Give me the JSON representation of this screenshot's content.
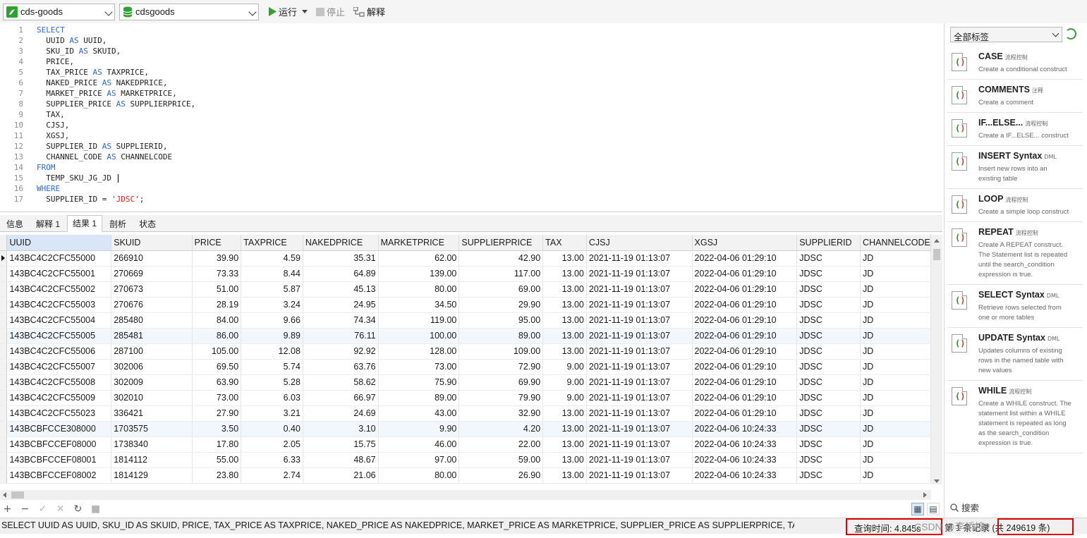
{
  "toolbar": {
    "connection": "cds-goods",
    "database": "cdsgoods",
    "run_label": "运行",
    "stop_label": "停止",
    "explain_label": "解释"
  },
  "editor": {
    "lines": [
      [
        {
          "t": "SELECT",
          "c": "kw"
        }
      ],
      [
        {
          "t": "  UUID "
        },
        {
          "t": "AS",
          "c": "kw"
        },
        {
          "t": " UUID,"
        }
      ],
      [
        {
          "t": "  SKU_ID "
        },
        {
          "t": "AS",
          "c": "kw"
        },
        {
          "t": " SKUID,"
        }
      ],
      [
        {
          "t": "  PRICE,"
        }
      ],
      [
        {
          "t": "  TAX_PRICE "
        },
        {
          "t": "AS",
          "c": "kw"
        },
        {
          "t": " TAXPRICE,"
        }
      ],
      [
        {
          "t": "  NAKED_PRICE "
        },
        {
          "t": "AS",
          "c": "kw"
        },
        {
          "t": " NAKEDPRICE,"
        }
      ],
      [
        {
          "t": "  MARKET_PRICE "
        },
        {
          "t": "AS",
          "c": "kw"
        },
        {
          "t": " MARKETPRICE,"
        }
      ],
      [
        {
          "t": "  SUPPLIER_PRICE "
        },
        {
          "t": "AS",
          "c": "kw"
        },
        {
          "t": " SUPPLIERPRICE,"
        }
      ],
      [
        {
          "t": "  TAX,"
        }
      ],
      [
        {
          "t": "  CJSJ,"
        }
      ],
      [
        {
          "t": "  XGSJ,"
        }
      ],
      [
        {
          "t": "  SUPPLIER_ID "
        },
        {
          "t": "AS",
          "c": "kw"
        },
        {
          "t": " SUPPLIERID,"
        }
      ],
      [
        {
          "t": "  CHANNEL_CODE "
        },
        {
          "t": "AS",
          "c": "kw"
        },
        {
          "t": " CHANNELCODE"
        }
      ],
      [
        {
          "t": "FROM",
          "c": "kw"
        }
      ],
      [
        {
          "t": "  TEMP_SKU_JG_JD "
        }
      ],
      [
        {
          "t": "WHERE",
          "c": "kw"
        }
      ],
      [
        {
          "t": "  SUPPLIER_ID = "
        },
        {
          "t": "'JDSC'",
          "c": "str"
        },
        {
          "t": ";"
        }
      ]
    ],
    "line_numbers": [
      "1",
      "2",
      "3",
      "4",
      "5",
      "6",
      "7",
      "8",
      "9",
      "10",
      "11",
      "12",
      "13",
      "14",
      "15",
      "16",
      "17"
    ]
  },
  "tabs": [
    "信息",
    "解释 1",
    "结果 1",
    "剖析",
    "状态"
  ],
  "active_tab": "结果 1",
  "grid": {
    "columns": [
      "UUID",
      "SKUID",
      "PRICE",
      "TAXPRICE",
      "NAKEDPRICE",
      "MARKETPRICE",
      "SUPPLIERPRICE",
      "TAX",
      "CJSJ",
      "XGSJ",
      "SUPPLIERID",
      "CHANNELCODE"
    ],
    "numeric": [
      false,
      false,
      true,
      true,
      true,
      true,
      true,
      true,
      false,
      false,
      false,
      false
    ],
    "rows": [
      [
        "143BC4C2CFC55000",
        "266910",
        "39.90",
        "4.59",
        "35.31",
        "62.00",
        "42.90",
        "13.00",
        "2021-11-19 01:13:07",
        "2022-04-06 01:29:10",
        "JDSC",
        "JD"
      ],
      [
        "143BC4C2CFC55001",
        "270669",
        "73.33",
        "8.44",
        "64.89",
        "139.00",
        "117.00",
        "13.00",
        "2021-11-19 01:13:07",
        "2022-04-06 01:29:10",
        "JDSC",
        "JD"
      ],
      [
        "143BC4C2CFC55002",
        "270673",
        "51.00",
        "5.87",
        "45.13",
        "80.00",
        "69.00",
        "13.00",
        "2021-11-19 01:13:07",
        "2022-04-06 01:29:10",
        "JDSC",
        "JD"
      ],
      [
        "143BC4C2CFC55003",
        "270676",
        "28.19",
        "3.24",
        "24.95",
        "34.50",
        "29.90",
        "13.00",
        "2021-11-19 01:13:07",
        "2022-04-06 01:29:10",
        "JDSC",
        "JD"
      ],
      [
        "143BC4C2CFC55004",
        "285480",
        "84.00",
        "9.66",
        "74.34",
        "119.00",
        "95.00",
        "13.00",
        "2021-11-19 01:13:07",
        "2022-04-06 01:29:10",
        "JDSC",
        "JD"
      ],
      [
        "143BC4C2CFC55005",
        "285481",
        "86.00",
        "9.89",
        "76.11",
        "100.00",
        "89.00",
        "13.00",
        "2021-11-19 01:13:07",
        "2022-04-06 01:29:10",
        "JDSC",
        "JD"
      ],
      [
        "143BC4C2CFC55006",
        "287100",
        "105.00",
        "12.08",
        "92.92",
        "128.00",
        "109.00",
        "13.00",
        "2021-11-19 01:13:07",
        "2022-04-06 01:29:10",
        "JDSC",
        "JD"
      ],
      [
        "143BC4C2CFC55007",
        "302006",
        "69.50",
        "5.74",
        "63.76",
        "73.00",
        "72.90",
        "9.00",
        "2021-11-19 01:13:07",
        "2022-04-06 01:29:10",
        "JDSC",
        "JD"
      ],
      [
        "143BC4C2CFC55008",
        "302009",
        "63.90",
        "5.28",
        "58.62",
        "75.90",
        "69.90",
        "9.00",
        "2021-11-19 01:13:07",
        "2022-04-06 01:29:10",
        "JDSC",
        "JD"
      ],
      [
        "143BC4C2CFC55009",
        "302010",
        "73.00",
        "6.03",
        "66.97",
        "89.00",
        "79.90",
        "9.00",
        "2021-11-19 01:13:07",
        "2022-04-06 01:29:10",
        "JDSC",
        "JD"
      ],
      [
        "143BC4C2CFC55023",
        "336421",
        "27.90",
        "3.21",
        "24.69",
        "43.00",
        "32.90",
        "13.00",
        "2021-11-19 01:13:07",
        "2022-04-06 01:29:10",
        "JDSC",
        "JD"
      ],
      [
        "143BCBFCCE308000",
        "1703575",
        "3.50",
        "0.40",
        "3.10",
        "9.90",
        "4.20",
        "13.00",
        "2021-11-19 01:13:07",
        "2022-04-06 10:24:33",
        "JDSC",
        "JD"
      ],
      [
        "143BCBFCCEF08000",
        "1738340",
        "17.80",
        "2.05",
        "15.75",
        "46.00",
        "22.00",
        "13.00",
        "2021-11-19 01:13:07",
        "2022-04-06 10:24:33",
        "JDSC",
        "JD"
      ],
      [
        "143BCBFCCEF08001",
        "1814112",
        "55.00",
        "6.33",
        "48.67",
        "97.00",
        "59.00",
        "13.00",
        "2021-11-19 01:13:07",
        "2022-04-06 10:24:33",
        "JDSC",
        "JD"
      ],
      [
        "143BCBFCCEF08002",
        "1814129",
        "23.80",
        "2.74",
        "21.06",
        "80.00",
        "26.90",
        "13.00",
        "2021-11-19 01:13:07",
        "2022-04-06 10:24:33",
        "JDSC",
        "JD"
      ]
    ]
  },
  "status": {
    "sql_text": "SELECT UUID AS UUID, SKU_ID AS SKUID, PRICE, TAX_PRICE AS TAXPRICE, NAKED_PRICE AS NAKEDPRICE, MARKET_PRICE AS MARKETPRICE, SUPPLIER_PRICE AS SUPPLIERPRICE, TAX, CJSJ, XGS",
    "query_time": "查询时间: 4.845s",
    "records": "第 1 条记录 (共 249619 条)",
    "watermark": "CSDN @李桥桉2"
  },
  "snippets": {
    "filter": "全部标签",
    "items": [
      {
        "title": "CASE",
        "tag": "流程控制",
        "desc": [
          "Create a conditional construct"
        ]
      },
      {
        "title": "COMMENTS",
        "tag": "注释",
        "desc": [
          "Create a comment"
        ]
      },
      {
        "title": "IF...ELSE...",
        "tag": "流程控制",
        "desc": [
          "Create a IF...ELSE... construct"
        ]
      },
      {
        "title": "INSERT Syntax",
        "tag": "DML",
        "desc": [
          "Insert new rows into an",
          "existing table"
        ]
      },
      {
        "title": "LOOP",
        "tag": "流程控制",
        "desc": [
          "Create a simple loop construct"
        ]
      },
      {
        "title": "REPEAT",
        "tag": "流程控制",
        "desc": [
          "Create A REPEAT construct.",
          "The Statement list is repeated",
          "until the search_condition",
          "expression is true."
        ]
      },
      {
        "title": "SELECT Syntax",
        "tag": "DML",
        "desc": [
          "Retrieve rows selected from",
          "one or more tables"
        ]
      },
      {
        "title": "UPDATE Syntax",
        "tag": "DML",
        "desc": [
          "Updates columns of existing",
          "rows in the named table with",
          "new values"
        ]
      },
      {
        "title": "WHILE",
        "tag": "流程控制",
        "desc": [
          "Create a WHILE construct. The",
          "statement list within a WHILE",
          "statement is repeated as long",
          "as the search_condition",
          "expression is true."
        ]
      }
    ],
    "search_label": "搜索"
  },
  "colors": {
    "keyword": "#2c68d9",
    "string": "#d8241f",
    "highlight_box": "#e00000",
    "run_icon": "#2fa32f",
    "db_icon": "#2fa32f"
  }
}
